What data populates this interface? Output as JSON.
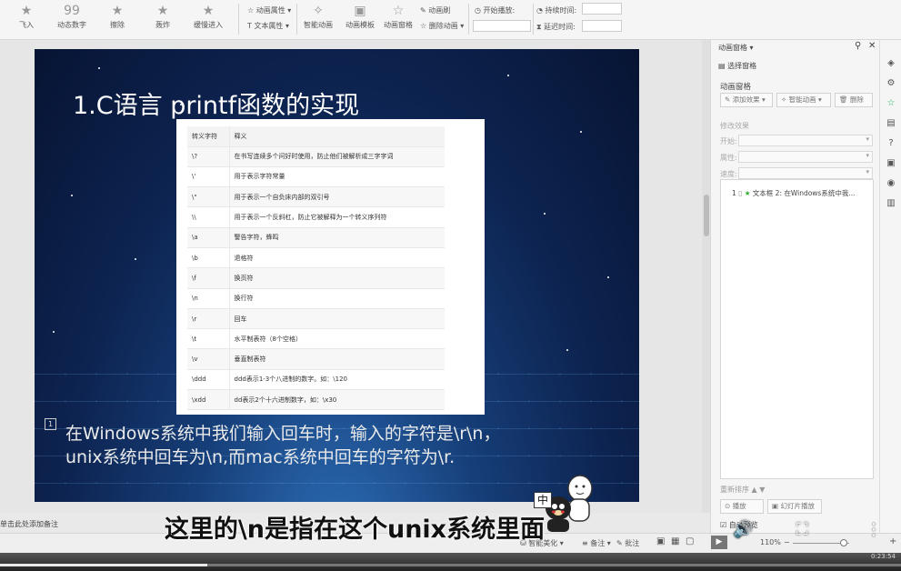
{
  "toolbar": {
    "groups": [
      {
        "label": "飞入",
        "icon": "fly-in-icon"
      },
      {
        "label": "动态数字",
        "icon": "dynamic-number-icon"
      },
      {
        "label": "擦除",
        "icon": "wipe-icon"
      },
      {
        "label": "轰炸",
        "icon": "bomb-star-icon"
      },
      {
        "label": "缓慢进入",
        "icon": "slow-enter-icon"
      }
    ],
    "animation_property": "动画属性",
    "text_property": "文本属性",
    "smart_animation": "智能动画",
    "animation_template": "动画模板",
    "animation_pane": "动画窗格",
    "animation_brush": "动画刷",
    "delete_animation": "删除动画",
    "start_play": "开始播放:",
    "duration": "持续时间:",
    "delay": "延迟时间:"
  },
  "slide": {
    "title": "1.C语言 printf函数的实现",
    "table": {
      "headers": [
        "转义字符",
        "释义"
      ],
      "rows": [
        [
          "\\?",
          "在书写连续多个问好时使用，防止他们被解析成三字字词"
        ],
        [
          "\\'",
          "用于表示字符常量"
        ],
        [
          "\\\"",
          "用于表示一个自负床内部的双引号"
        ],
        [
          "\\\\",
          "用于表示一个反斜杠，防止它被解释为一个转义序列符"
        ],
        [
          "\\a",
          "警告字符，蜂鸣"
        ],
        [
          "\\b",
          "退格符"
        ],
        [
          "\\f",
          "换页符"
        ],
        [
          "\\n",
          "换行符"
        ],
        [
          "\\r",
          "回车"
        ],
        [
          "\\t",
          "水平制表符（8个空格）"
        ],
        [
          "\\v",
          "垂直制表符"
        ],
        [
          "\\ddd",
          "ddd表示1-3个八进制的数字。如：\\120"
        ],
        [
          "\\xdd",
          "dd表示2个十六进制数字，如：\\x30"
        ]
      ]
    },
    "paragraph_number": "1",
    "paragraph_line1": "在Windows系统中我们输入回车时，输入的字符是\\r\\n，",
    "paragraph_line2": "unix系统中回车为\\n,而mac系统中回车的字符为\\r."
  },
  "subtitle": "这里的\\n是指在这个unix系统里面",
  "notes": "单击此处添加备注",
  "ime": "中",
  "panel": {
    "title": "动画窗格",
    "select_pane": "选择窗格",
    "section": "动画窗格",
    "add_effect": "添加效果",
    "smart_animation": "智能动画",
    "delete": "删除",
    "modify": "修改效果",
    "start": "开始:",
    "property": "属性:",
    "speed": "速度:",
    "item_number": "1",
    "item_text": "文本框 2: 在Windows系统中我...",
    "reorder": "重新排序",
    "play": "播放",
    "slideshow": "幻灯片播放",
    "autopreview": "自动预览"
  },
  "statusbar": {
    "smart_beautify": "智能美化",
    "notes": "备注",
    "comments": "批注",
    "zoom": "110%"
  },
  "player": {
    "time": "0:23:54",
    "progress": 0.23
  }
}
